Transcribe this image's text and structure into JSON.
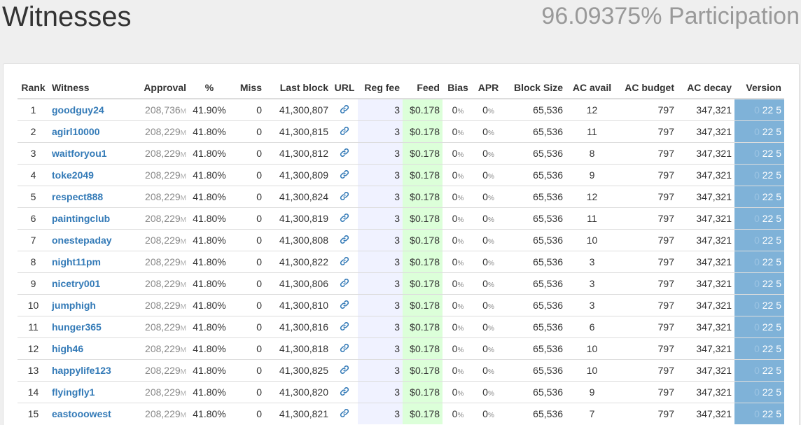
{
  "header": {
    "title": "Witnesses",
    "participation": "96.09375% Participation"
  },
  "table": {
    "columns": [
      "Rank",
      "Witness",
      "Approval",
      "%",
      "Miss",
      "Last block",
      "URL",
      "Reg fee",
      "Feed",
      "Bias",
      "APR",
      "Block Size",
      "AC avail",
      "AC budget",
      "AC decay",
      "Version"
    ],
    "approval_unit": "M",
    "pct_unit": "%",
    "url_icon": "link-icon",
    "rows": [
      {
        "rank": "1",
        "witness": "goodguy24",
        "approval": "208,736",
        "pct": "41.90%",
        "miss": "0",
        "last_block": "41,300,807",
        "reg_fee": "3",
        "feed": "$0.178",
        "bias": "0",
        "apr": "0",
        "block_size": "65,536",
        "ac_avail": "12",
        "ac_budget": "797",
        "ac_decay": "347,321",
        "version_major": "0",
        "version_rest": "22 5"
      },
      {
        "rank": "2",
        "witness": "agirl10000",
        "approval": "208,229",
        "pct": "41.80%",
        "miss": "0",
        "last_block": "41,300,815",
        "reg_fee": "3",
        "feed": "$0.178",
        "bias": "0",
        "apr": "0",
        "block_size": "65,536",
        "ac_avail": "11",
        "ac_budget": "797",
        "ac_decay": "347,321",
        "version_major": "0",
        "version_rest": "22 5"
      },
      {
        "rank": "3",
        "witness": "waitforyou1",
        "approval": "208,229",
        "pct": "41.80%",
        "miss": "0",
        "last_block": "41,300,812",
        "reg_fee": "3",
        "feed": "$0.178",
        "bias": "0",
        "apr": "0",
        "block_size": "65,536",
        "ac_avail": "8",
        "ac_budget": "797",
        "ac_decay": "347,321",
        "version_major": "0",
        "version_rest": "22 5"
      },
      {
        "rank": "4",
        "witness": "toke2049",
        "approval": "208,229",
        "pct": "41.80%",
        "miss": "0",
        "last_block": "41,300,809",
        "reg_fee": "3",
        "feed": "$0.178",
        "bias": "0",
        "apr": "0",
        "block_size": "65,536",
        "ac_avail": "9",
        "ac_budget": "797",
        "ac_decay": "347,321",
        "version_major": "0",
        "version_rest": "22 5"
      },
      {
        "rank": "5",
        "witness": "respect888",
        "approval": "208,229",
        "pct": "41.80%",
        "miss": "0",
        "last_block": "41,300,824",
        "reg_fee": "3",
        "feed": "$0.178",
        "bias": "0",
        "apr": "0",
        "block_size": "65,536",
        "ac_avail": "12",
        "ac_budget": "797",
        "ac_decay": "347,321",
        "version_major": "0",
        "version_rest": "22 5"
      },
      {
        "rank": "6",
        "witness": "paintingclub",
        "approval": "208,229",
        "pct": "41.80%",
        "miss": "0",
        "last_block": "41,300,819",
        "reg_fee": "3",
        "feed": "$0.178",
        "bias": "0",
        "apr": "0",
        "block_size": "65,536",
        "ac_avail": "11",
        "ac_budget": "797",
        "ac_decay": "347,321",
        "version_major": "0",
        "version_rest": "22 5"
      },
      {
        "rank": "7",
        "witness": "onestepaday",
        "approval": "208,229",
        "pct": "41.80%",
        "miss": "0",
        "last_block": "41,300,808",
        "reg_fee": "3",
        "feed": "$0.178",
        "bias": "0",
        "apr": "0",
        "block_size": "65,536",
        "ac_avail": "10",
        "ac_budget": "797",
        "ac_decay": "347,321",
        "version_major": "0",
        "version_rest": "22 5"
      },
      {
        "rank": "8",
        "witness": "night11pm",
        "approval": "208,229",
        "pct": "41.80%",
        "miss": "0",
        "last_block": "41,300,822",
        "reg_fee": "3",
        "feed": "$0.178",
        "bias": "0",
        "apr": "0",
        "block_size": "65,536",
        "ac_avail": "3",
        "ac_budget": "797",
        "ac_decay": "347,321",
        "version_major": "0",
        "version_rest": "22 5"
      },
      {
        "rank": "9",
        "witness": "nicetry001",
        "approval": "208,229",
        "pct": "41.80%",
        "miss": "0",
        "last_block": "41,300,806",
        "reg_fee": "3",
        "feed": "$0.178",
        "bias": "0",
        "apr": "0",
        "block_size": "65,536",
        "ac_avail": "3",
        "ac_budget": "797",
        "ac_decay": "347,321",
        "version_major": "0",
        "version_rest": "22 5"
      },
      {
        "rank": "10",
        "witness": "jumphigh",
        "approval": "208,229",
        "pct": "41.80%",
        "miss": "0",
        "last_block": "41,300,810",
        "reg_fee": "3",
        "feed": "$0.178",
        "bias": "0",
        "apr": "0",
        "block_size": "65,536",
        "ac_avail": "3",
        "ac_budget": "797",
        "ac_decay": "347,321",
        "version_major": "0",
        "version_rest": "22 5"
      },
      {
        "rank": "11",
        "witness": "hunger365",
        "approval": "208,229",
        "pct": "41.80%",
        "miss": "0",
        "last_block": "41,300,816",
        "reg_fee": "3",
        "feed": "$0.178",
        "bias": "0",
        "apr": "0",
        "block_size": "65,536",
        "ac_avail": "6",
        "ac_budget": "797",
        "ac_decay": "347,321",
        "version_major": "0",
        "version_rest": "22 5"
      },
      {
        "rank": "12",
        "witness": "high46",
        "approval": "208,229",
        "pct": "41.80%",
        "miss": "0",
        "last_block": "41,300,818",
        "reg_fee": "3",
        "feed": "$0.178",
        "bias": "0",
        "apr": "0",
        "block_size": "65,536",
        "ac_avail": "10",
        "ac_budget": "797",
        "ac_decay": "347,321",
        "version_major": "0",
        "version_rest": "22 5"
      },
      {
        "rank": "13",
        "witness": "happylife123",
        "approval": "208,229",
        "pct": "41.80%",
        "miss": "0",
        "last_block": "41,300,825",
        "reg_fee": "3",
        "feed": "$0.178",
        "bias": "0",
        "apr": "0",
        "block_size": "65,536",
        "ac_avail": "10",
        "ac_budget": "797",
        "ac_decay": "347,321",
        "version_major": "0",
        "version_rest": "22 5"
      },
      {
        "rank": "14",
        "witness": "flyingfly1",
        "approval": "208,229",
        "pct": "41.80%",
        "miss": "0",
        "last_block": "41,300,820",
        "reg_fee": "3",
        "feed": "$0.178",
        "bias": "0",
        "apr": "0",
        "block_size": "65,536",
        "ac_avail": "9",
        "ac_budget": "797",
        "ac_decay": "347,321",
        "version_major": "0",
        "version_rest": "22 5"
      },
      {
        "rank": "15",
        "witness": "eastooowest",
        "approval": "208,229",
        "pct": "41.80%",
        "miss": "0",
        "last_block": "41,300,821",
        "reg_fee": "3",
        "feed": "$0.178",
        "bias": "0",
        "apr": "0",
        "block_size": "65,536",
        "ac_avail": "7",
        "ac_budget": "797",
        "ac_decay": "347,321",
        "version_major": "0",
        "version_rest": "22 5"
      }
    ]
  },
  "colors": {
    "link": "#337ab7",
    "reg_fee_bg": "#f0f2ff",
    "feed_bg": "#dcffd9",
    "version_bg": "#7fb2d8"
  }
}
